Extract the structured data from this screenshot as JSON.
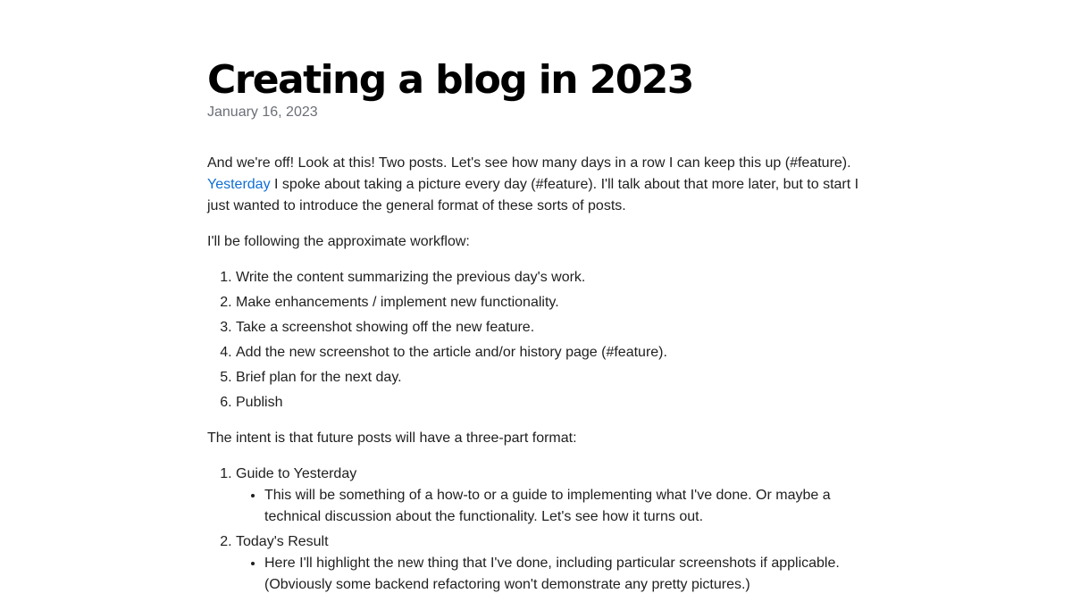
{
  "post": {
    "title": "Creating a blog in 2023",
    "date": "January 16, 2023"
  },
  "intro": {
    "part1": "And we're off! Look at this! Two posts. Let's see how many days in a row I can keep this up (#feature). ",
    "link_text": "Yesterday",
    "part2": " I spoke about taking a picture every day (#feature). I'll talk about that more later, but to start I just wanted to introduce the general format of these sorts of posts."
  },
  "workflow": {
    "intro": "I'll be following the approximate workflow:",
    "steps": [
      "Write the content summarizing the previous day's work.",
      "Make enhancements / implement new functionality.",
      "Take a screenshot showing off the new feature.",
      "Add the new screenshot to the article and/or history page (#feature).",
      "Brief plan for the next day.",
      "Publish"
    ]
  },
  "format": {
    "intro": "The intent is that future posts will have a three-part format:",
    "parts": [
      {
        "title": "Guide to Yesterday",
        "detail": "This will be something of a how-to or a guide to implementing what I've done. Or maybe a technical discussion about the functionality. Let's see how it turns out."
      },
      {
        "title": "Today's Result",
        "detail": "Here I'll highlight the new thing that I've done, including particular screenshots if applicable. (Obviously some backend refactoring won't demonstrate any pretty pictures.)"
      }
    ]
  }
}
